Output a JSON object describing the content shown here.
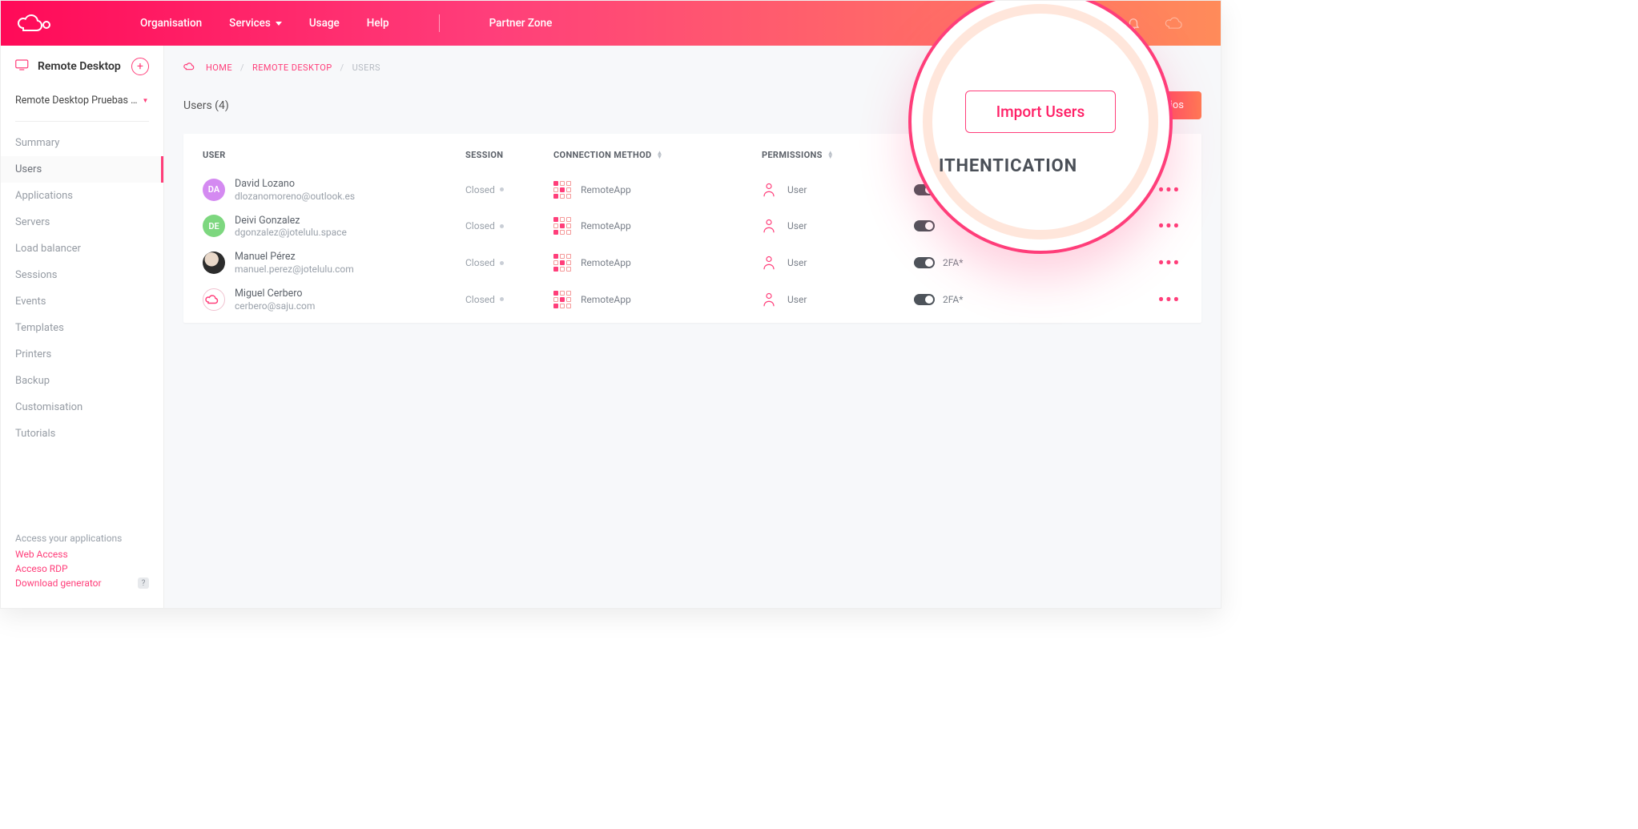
{
  "nav": {
    "items": [
      "Organisation",
      "Services",
      "Usage",
      "Help"
    ],
    "partner": "Partner Zone"
  },
  "sidebar": {
    "title": "Remote Desktop",
    "project": "Remote Desktop Pruebas …",
    "items": [
      "Summary",
      "Users",
      "Applications",
      "Servers",
      "Load balancer",
      "Sessions",
      "Events",
      "Templates",
      "Printers",
      "Backup",
      "Customisation",
      "Tutorials"
    ],
    "active_index": 1,
    "footer": {
      "header": "Access your applications",
      "links": [
        "Web Access",
        "Acceso RDP",
        "Download generator"
      ]
    }
  },
  "breadcrumb": {
    "home": "HOME",
    "mid": "REMOTE DESKTOP",
    "cur": "USERS"
  },
  "heading": "Users (4)",
  "right_button": "suarios",
  "columns": {
    "user": "USER",
    "session": "SESSION",
    "conn": "CONNECTION METHOD",
    "perm": "PERMISSIONS",
    "auth": "ITHENTICATION"
  },
  "callout": {
    "button": "Import Users",
    "subhead": "ITHENTICATION"
  },
  "rows": [
    {
      "avatar_text": "DA",
      "avatar_class": "av-da",
      "name": "David Lozano",
      "email": "dlozanomoreno@outlook.es",
      "session": "Closed",
      "conn": "RemoteApp",
      "perm": "User",
      "auth": ""
    },
    {
      "avatar_text": "DE",
      "avatar_class": "av-de",
      "name": "Deivi Gonzalez",
      "email": "dgonzalez@jotelulu.space",
      "session": "Closed",
      "conn": "RemoteApp",
      "perm": "User",
      "auth": ""
    },
    {
      "avatar_text": "",
      "avatar_class": "av-photo",
      "name": "Manuel Pérez",
      "email": "manuel.perez@jotelulu.com",
      "session": "Closed",
      "conn": "RemoteApp",
      "perm": "User",
      "auth": "2FA*"
    },
    {
      "avatar_text": "",
      "avatar_class": "av-logo",
      "name": "Miguel Cerbero",
      "email": "cerbero@saju.com",
      "session": "Closed",
      "conn": "RemoteApp",
      "perm": "User",
      "auth": "2FA*"
    }
  ]
}
